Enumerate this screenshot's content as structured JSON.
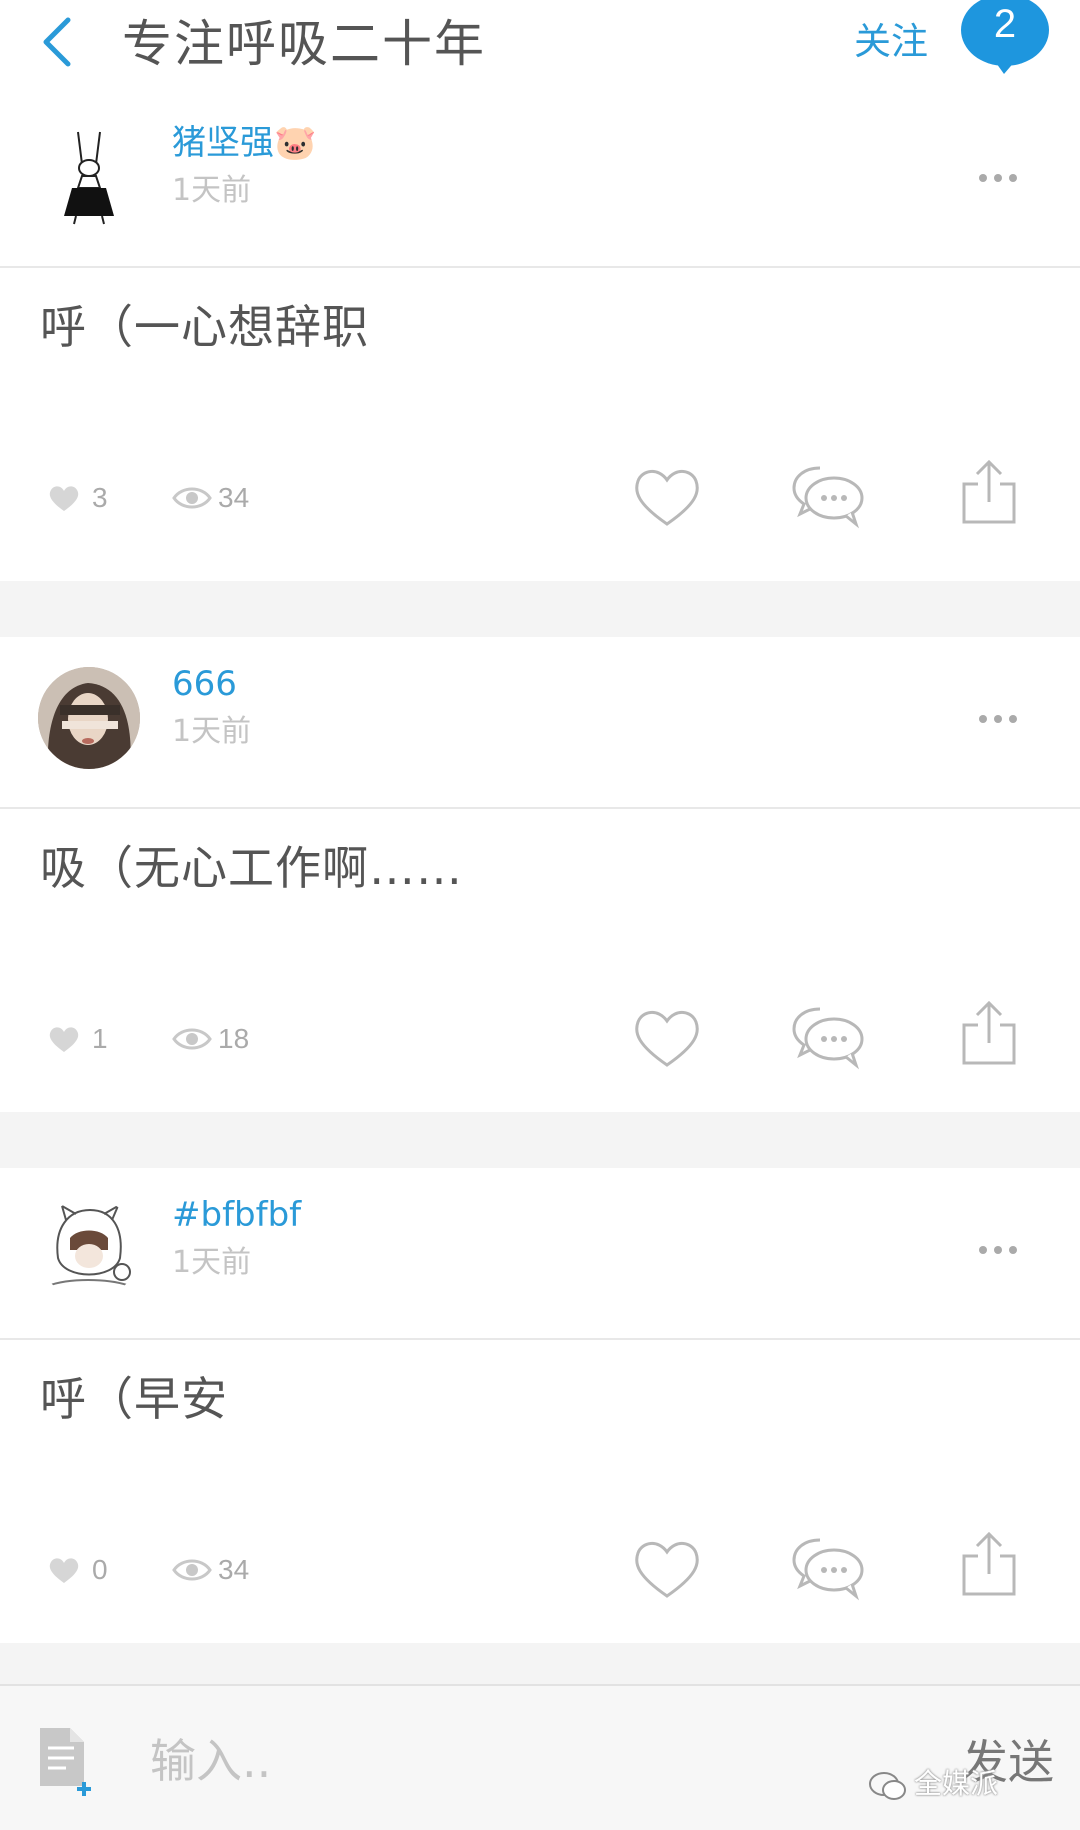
{
  "header": {
    "title": "专注呼吸二十年",
    "follow_label": "关注",
    "badge_count": "2"
  },
  "posts": [
    {
      "username": "猪坚强🐷",
      "time": "1天前",
      "text": "呼（一心想辞职",
      "likes": "3",
      "views": "34"
    },
    {
      "username": "666",
      "time": "1天前",
      "text": "吸（无心工作啊……",
      "likes": "1",
      "views": "18"
    },
    {
      "username": "#bfbfbf",
      "time": "1天前",
      "text": "呼（早安",
      "likes": "0",
      "views": "34"
    }
  ],
  "input_bar": {
    "placeholder": "输入..",
    "send_label": "发送"
  },
  "watermark": "全媒派",
  "colors": {
    "accent": "#2a9ad8",
    "icon_gray": "#bdbdbd",
    "divider": "#e8e8e8"
  }
}
